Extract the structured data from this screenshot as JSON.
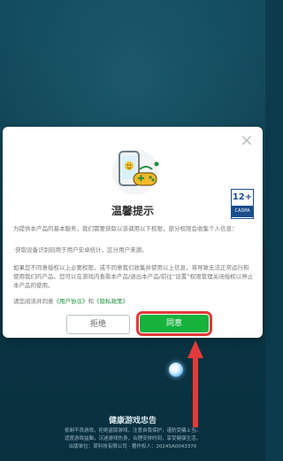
{
  "dialog": {
    "title": "温馨提示",
    "age_badge": {
      "number": "12+",
      "label": "CADPA"
    },
    "paragraphs": {
      "p1": "为提供本产品的基本服务，我们需要获取以该调用以下权限，部分权限会收集个人信息：",
      "p2": "·获取设备识别码用于用户安卓统计，区分用户来源。",
      "p3": "如果您不同意授权以上必要权限，或不同意我们收集并使用以上信息，将导致无法正常运行和使用我们的产品。您可以在游戏内查看本产品/退出本产品/前往“设置”权限管理关闭授权以停止本产品的使用。",
      "p4_prefix": "请您阅读并同意",
      "user_agreement": "《用户协议》",
      "p4_and": "和",
      "privacy_policy": "《隐私政策》"
    },
    "buttons": {
      "reject": "拒绝",
      "agree": "同意"
    }
  },
  "footer": {
    "title": "健康游戏忠告",
    "line1": "抵制不良游戏，拒绝盗版游戏，注意自我保护，谨防受骗上当。",
    "line2": "适度游戏益脑，沉迷游戏伤身，合理安排时间，享受健康生活。",
    "line3": "出版单位：某科技有限公司 · 著作权人：2024SA0043370"
  },
  "colors": {
    "accent_green": "#17b33d",
    "highlight_red": "#e23a3a",
    "background": "#0b3b4c"
  }
}
